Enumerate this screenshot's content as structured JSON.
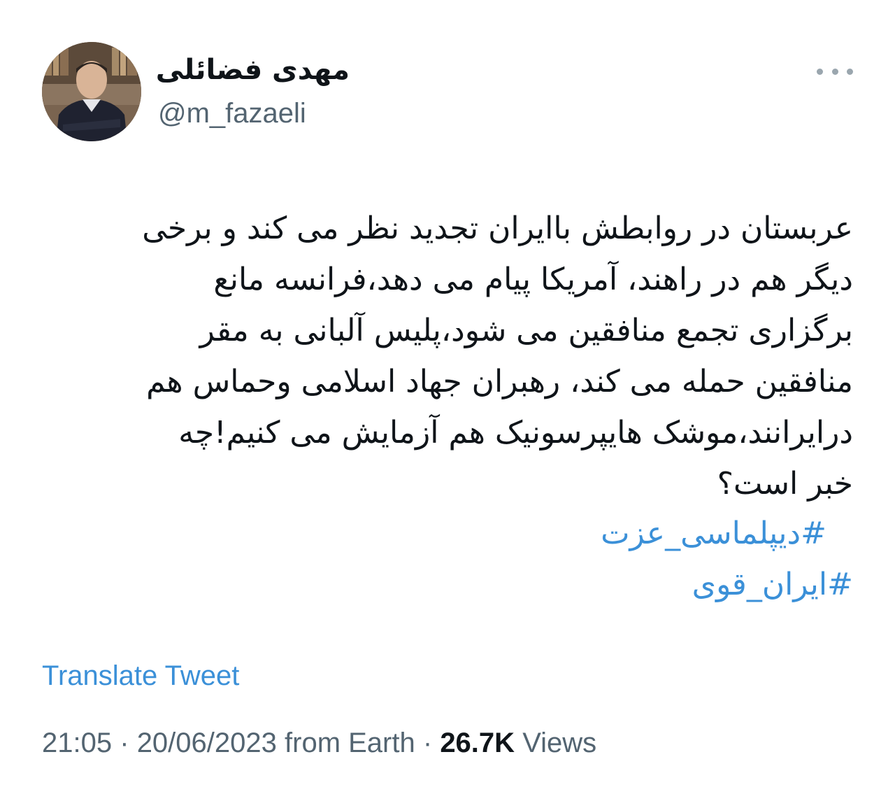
{
  "author": {
    "display_name": "مهدی فضائلی",
    "handle": "@m_fazaeli",
    "avatar_icon": "profile-photo"
  },
  "more_button_icon": "more-horizontal-icon",
  "tweet": {
    "lines": [
      "عربستان در روابطش باایران تجدید نظر می کند و برخی",
      "دیگر هم در راهند، آمریکا پیام می دهد،فرانسه مانع",
      "برگزاری تجمع منافقین می شود،پلیس آلبانی به مقر",
      "منافقین حمله می کند، رهبران جهاد اسلامی وحماس هم",
      "درایرانند،موشک هایپرسونیک هم آزمایش می کنیم!چه",
      "خبر است؟"
    ],
    "hashtags": [
      "#دیپلماسی_عزت",
      "#ایران_قوی"
    ]
  },
  "translate_label": "Translate Tweet",
  "meta": {
    "time": "21:05",
    "date": "20/06/2023",
    "source": "from Earth",
    "separator": "·",
    "views_count": "26.7K",
    "views_label": "Views"
  },
  "colors": {
    "link": "#3b90d8",
    "secondary_text": "#536471",
    "primary_text": "#0f1419"
  }
}
